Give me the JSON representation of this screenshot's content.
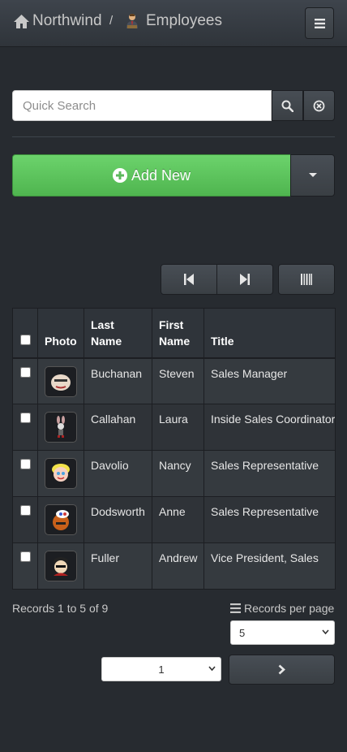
{
  "navbar": {
    "home_label": "Northwind",
    "separator": "/",
    "page_label": "Employees",
    "menu_icon": "hamburger-icon"
  },
  "search": {
    "placeholder": "Quick Search",
    "search_icon": "search-icon",
    "clear_icon": "clear-circle-icon"
  },
  "actions": {
    "add_label": "Add New",
    "add_icon": "plus-circle-icon",
    "caret_icon": "caret-down-icon"
  },
  "pager_top": {
    "first_icon": "step-backward-icon",
    "last_icon": "step-forward-icon",
    "columns_icon": "columns-icon"
  },
  "table": {
    "headers": {
      "photo": "Photo",
      "last_name_line1": "Last",
      "last_name_line2": "Name",
      "first_name_line1": "First",
      "first_name_line2": "Name",
      "title": "Title"
    },
    "rows": [
      {
        "last": "Buchanan",
        "first": "Steven",
        "title": "Sales Manager"
      },
      {
        "last": "Callahan",
        "first": "Laura",
        "title": "Inside Sales Coordinator"
      },
      {
        "last": "Davolio",
        "first": "Nancy",
        "title": "Sales Representative"
      },
      {
        "last": "Dodsworth",
        "first": "Anne",
        "title": "Sales Representative"
      },
      {
        "last": "Fuller",
        "first": "Andrew",
        "title": "Vice President, Sales"
      }
    ]
  },
  "footer": {
    "records_text": "Records 1 to 5 of 9",
    "records_per_page_label": "Records per page",
    "records_per_page_value": "5",
    "page_value": "1",
    "next_icon": "chevron-right-icon"
  },
  "colors": {
    "background": "#272b30",
    "accent_green": "#5cb85c",
    "navbar": "#3a3f44"
  }
}
